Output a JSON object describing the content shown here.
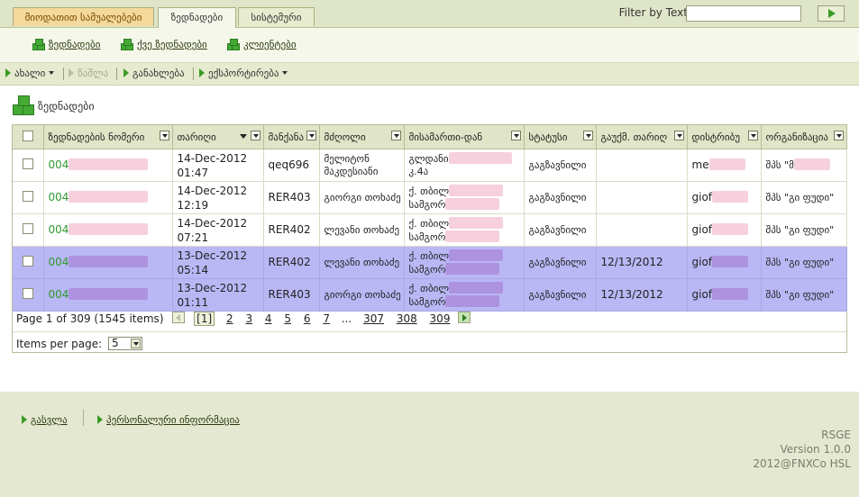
{
  "tabs": [
    {
      "label": "მიოდათით სამუალებები"
    },
    {
      "label": "ზედნადები"
    },
    {
      "label": "სისტემური"
    }
  ],
  "filter": {
    "label": "Filter by Text",
    "value": "",
    "placeholder": ""
  },
  "submenu": [
    {
      "label": "ზედნადები"
    },
    {
      "label": "ქვე ზედნადები"
    },
    {
      "label": "კლიენტები"
    }
  ],
  "toolbar": {
    "new": "ახალი",
    "delete": "წაშლა",
    "refresh": "განახლება",
    "export": "ექსპორტირება"
  },
  "page_title": "ზედნადები",
  "grid": {
    "columns": [
      "ზედნადების ნომერი",
      "თარიღი",
      "მანქანა",
      "მძღოლი",
      "მისამართი-დან",
      "სტატუსი",
      "გაუქმ. თარიღ",
      "დისტრიბუ",
      "ორგანიზაცია"
    ],
    "rows": [
      {
        "number": "004",
        "date": "14-Dec-2012",
        "time": "01:47",
        "car": "qeq696",
        "driver": "მელიტონ მაკდესიანი",
        "address1": "გლდანი",
        "address2": "კ.4ა",
        "status": "გაგზავნილი",
        "cancel_date": "",
        "distributor": "me",
        "org": "შპს \"მ"
      },
      {
        "number": "004",
        "date": "14-Dec-2012",
        "time": "12:19",
        "car": "RER403",
        "driver": "გიორგი თოხაძე",
        "address1": "ქ. თბილ",
        "address2": "სამგორ",
        "status": "გაგზავნილი",
        "cancel_date": "",
        "distributor": "giof",
        "org": "შპს \"გი ფუდი\""
      },
      {
        "number": "004",
        "date": "14-Dec-2012",
        "time": "07:21",
        "car": "RER402",
        "driver": "ლევანი თოხაძე",
        "address1": "ქ. თბილ",
        "address2": "სამგორ",
        "status": "გაგზავნილი",
        "cancel_date": "",
        "distributor": "giof",
        "org": "შპს \"გი ფუდი\""
      },
      {
        "number": "004",
        "date": "13-Dec-2012",
        "time": "05:14",
        "car": "RER402",
        "driver": "ლევანი თოხაძე",
        "address1": "ქ. თბილ",
        "address2": "სამგორ",
        "status": "გაგზავნილი",
        "cancel_date": "12/13/2012",
        "distributor": "giof",
        "org": "შპს \"გი ფუდი\""
      },
      {
        "number": "004",
        "date": "13-Dec-2012",
        "time": "01:11",
        "car": "RER403",
        "driver": "გიორგი თოხაძე",
        "address1": "ქ. თბილ",
        "address2": "სამგორ",
        "status": "გაგზავნილი",
        "cancel_date": "12/13/2012",
        "distributor": "giof",
        "org": "შპს \"გი ფუდი\""
      }
    ]
  },
  "pager": {
    "summary": "Page 1 of 309 (1545 items)",
    "current": "[1]",
    "pages": [
      "2",
      "3",
      "4",
      "5",
      "6",
      "7"
    ],
    "ellipsis": "...",
    "last_pages": [
      "307",
      "308",
      "309"
    ],
    "items_per_page_label": "Items per page:",
    "items_per_page": "5"
  },
  "footer": {
    "logout": "გასვლა",
    "personal_info": "პერსონალური ინფორმაცია",
    "app_name": "RSGE",
    "version": "Version 1.0.0",
    "copyright": "2012@FNXCo HSL"
  },
  "colors": {
    "accent_green": "#3c9a26",
    "selected_row": "#bab7f5",
    "tab_highlight": "#f3d99b"
  }
}
